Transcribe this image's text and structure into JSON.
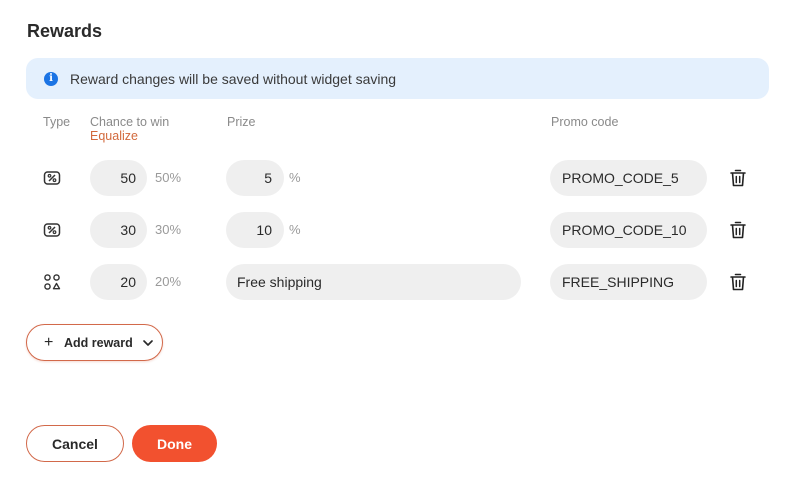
{
  "title": "Rewards",
  "info_banner": {
    "icon": "info-icon",
    "text": "Reward changes will be saved without widget saving"
  },
  "headers": {
    "type": "Type",
    "chance": "Chance to win",
    "equalize": "Equalize",
    "prize": "Prize",
    "promo": "Promo code"
  },
  "rewards": [
    {
      "type_icon": "discount-percent-icon",
      "chance": "50",
      "chance_pct": "50%",
      "prize": "5",
      "prize_unit": "%",
      "promo_code": "PROMO_CODE_5"
    },
    {
      "type_icon": "discount-percent-icon",
      "chance": "30",
      "chance_pct": "30%",
      "prize": "10",
      "prize_unit": "%",
      "promo_code": "PROMO_CODE_10"
    },
    {
      "type_icon": "free-shipping-icon",
      "chance": "20",
      "chance_pct": "20%",
      "prize": "Free shipping",
      "promo_code": "FREE_SHIPPING"
    }
  ],
  "add_reward_label": "Add reward",
  "cancel_label": "Cancel",
  "done_label": "Done",
  "colors": {
    "accent": "#f2512f",
    "outline": "#d2694a",
    "info_bg": "#e4f0fd",
    "info_icon": "#1b74e4",
    "link": "#d2693c"
  }
}
